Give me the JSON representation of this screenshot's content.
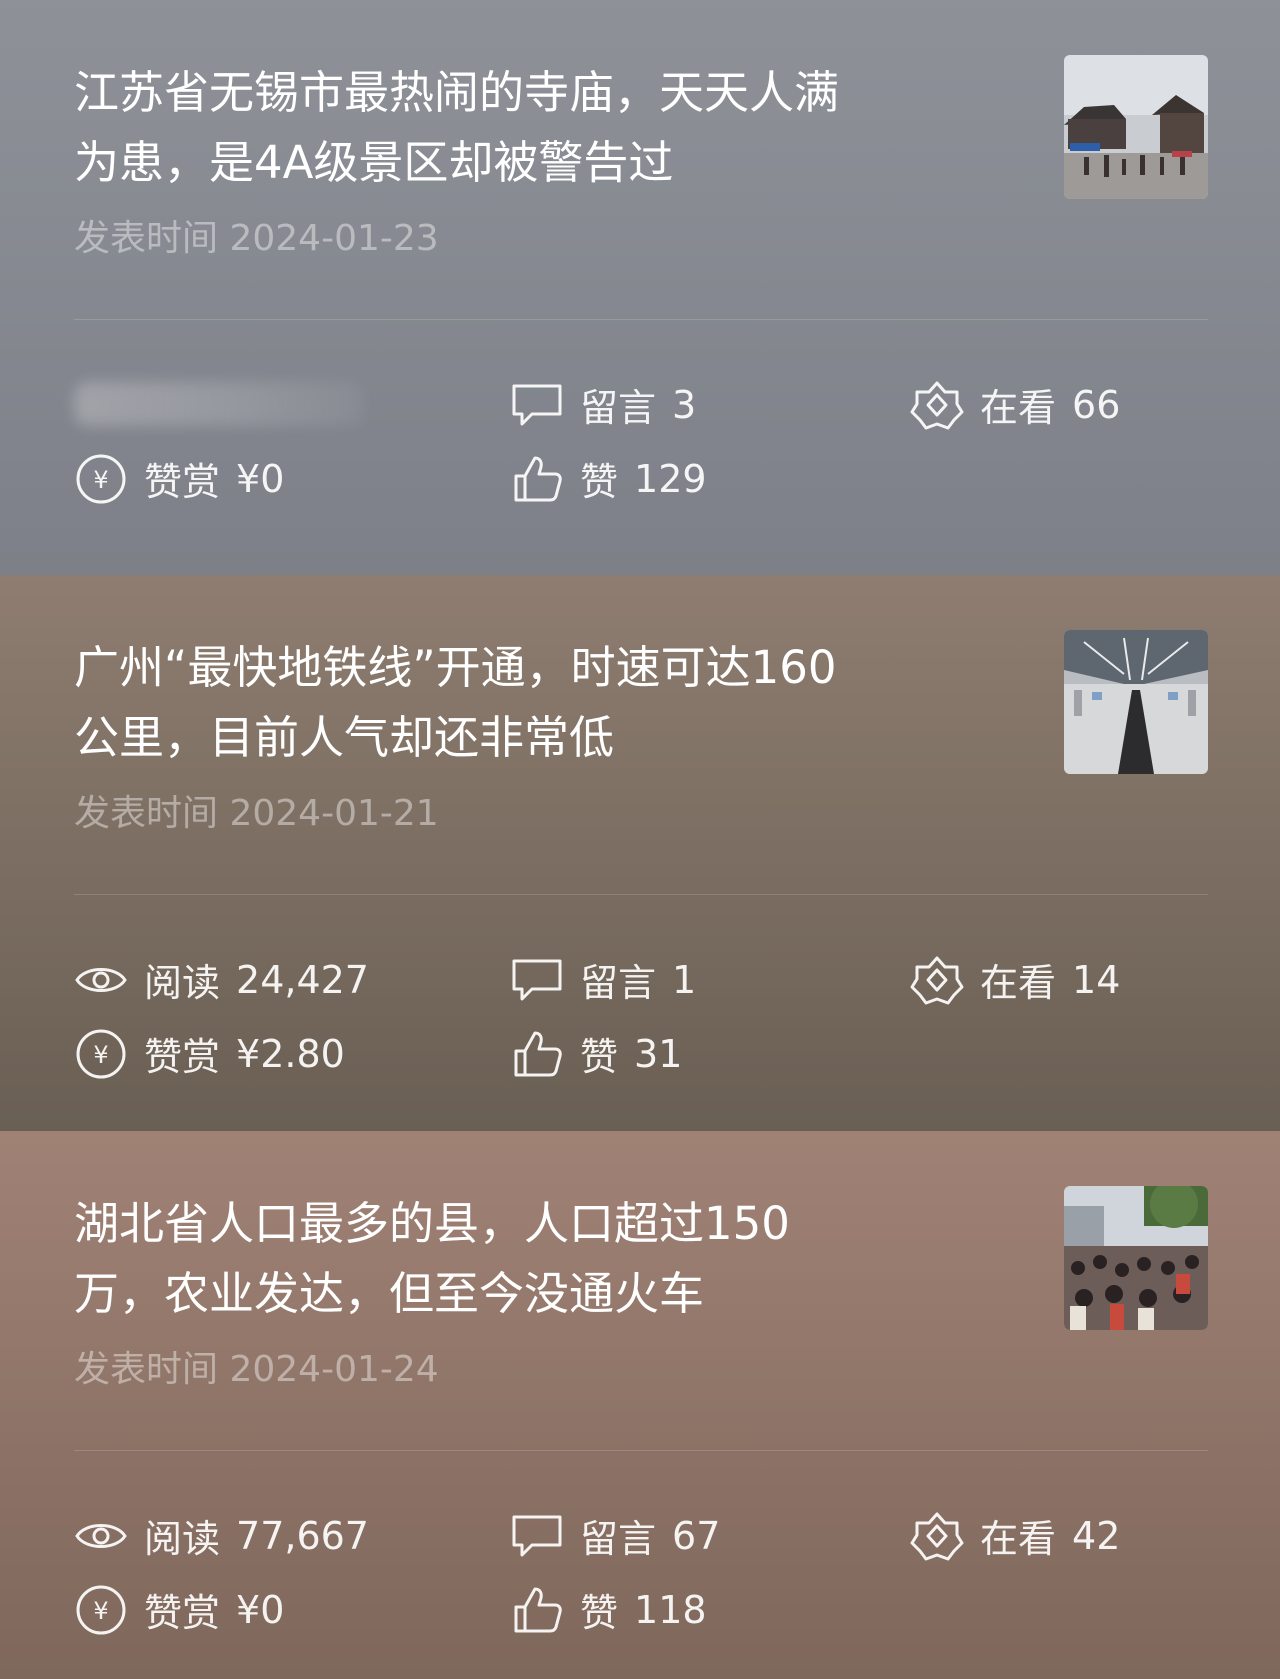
{
  "articles": [
    {
      "title_line1": "江苏省无锡市最热闹的寺庙，天天人满",
      "title_line2": "为患，是4A级景区却被警告过",
      "date_label": "发表时间",
      "date": "2024-01-23",
      "thumbnail": "temple-square-photo",
      "read": null,
      "comment_label": "留言",
      "comments": "3",
      "watching_label": "在看",
      "watching": "66",
      "reward_label": "赞赏",
      "reward": "¥0",
      "like_label": "赞",
      "likes": "129"
    },
    {
      "title_line1": "广州“最快地铁线”开通，时速可达160",
      "title_line2": "公里，目前人气却还非常低",
      "date_label": "发表时间",
      "date": "2024-01-21",
      "thumbnail": "metro-station-photo",
      "read_label": "阅读",
      "read": "24,427",
      "comment_label": "留言",
      "comments": "1",
      "watching_label": "在看",
      "watching": "14",
      "reward_label": "赞赏",
      "reward": "¥2.80",
      "like_label": "赞",
      "likes": "31"
    },
    {
      "title_line1": "湖北省人口最多的县，人口超过150",
      "title_line2": "万，农业发达，但至今没通火车",
      "date_label": "发表时间",
      "date": "2024-01-24",
      "thumbnail": "crowded-street-photo",
      "read_label": "阅读",
      "read": "77,667",
      "comment_label": "留言",
      "comments": "67",
      "watching_label": "在看",
      "watching": "42",
      "reward_label": "赞赏",
      "reward": "¥0",
      "like_label": "赞",
      "likes": "118"
    }
  ],
  "icons": {
    "read": "eye-icon",
    "comment": "comment-bubble-icon",
    "watching": "wow-flower-icon",
    "reward": "yen-coin-icon",
    "like": "thumbs-up-icon"
  }
}
